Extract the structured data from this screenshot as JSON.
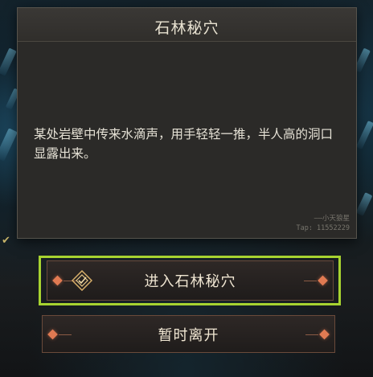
{
  "background": {
    "partial_label_top": "",
    "partial_label_left": "",
    "check_icon": "check-icon"
  },
  "dialog": {
    "title": "石林秘穴",
    "body": "某处岩壁中传来水滴声，用手轻轻一推，半人高的洞口显露出来。",
    "signature_line1": "——小天狼星",
    "signature_line2": "Tap: 11552229"
  },
  "buttons": {
    "enter_label": "进入石林秘穴",
    "leave_label": "暂时离开"
  },
  "colors": {
    "highlight": "#a7d330",
    "accent_diamond": "#e07a52",
    "dialog_bg": "#2b2a28"
  }
}
